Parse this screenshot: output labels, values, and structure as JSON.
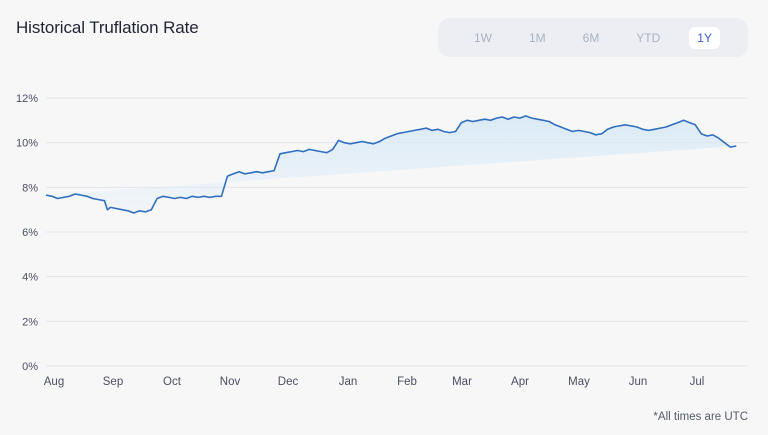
{
  "title": "Historical Truflation Rate",
  "range_selector": {
    "options": [
      "1W",
      "1M",
      "6M",
      "YTD",
      "1Y"
    ],
    "selected": "1Y"
  },
  "footnote": "*All times are UTC",
  "colors": {
    "line": "#2f6fbf",
    "fill_top": "#d9eaf7",
    "grid": "#e3e5ea",
    "axis_text": "#4b5060"
  },
  "chart_data": {
    "type": "area",
    "title": "Historical Truflation Rate",
    "xlabel": "",
    "ylabel": "",
    "x_ticks": [
      "Aug",
      "Sep",
      "Oct",
      "Nov",
      "Dec",
      "Jan",
      "Feb",
      "Mar",
      "Apr",
      "May",
      "Jun",
      "Jul"
    ],
    "y_ticks": [
      "0%",
      "2%",
      "4%",
      "6%",
      "8%",
      "10%",
      "12%"
    ],
    "ylim": [
      0,
      12
    ],
    "grid": true,
    "x": [
      0,
      0.1,
      0.2,
      0.3,
      0.4,
      0.5,
      0.6,
      0.7,
      0.8,
      0.9,
      1.0,
      1.05,
      1.1,
      1.2,
      1.3,
      1.4,
      1.5,
      1.6,
      1.7,
      1.8,
      1.9,
      2.0,
      2.1,
      2.2,
      2.3,
      2.4,
      2.5,
      2.6,
      2.7,
      2.8,
      2.9,
      3.0,
      3.1,
      3.15,
      3.2,
      3.3,
      3.4,
      3.5,
      3.6,
      3.7,
      3.8,
      3.9,
      4.0,
      4.1,
      4.2,
      4.3,
      4.4,
      4.5,
      4.6,
      4.7,
      4.8,
      4.9,
      5.0,
      5.1,
      5.2,
      5.3,
      5.4,
      5.5,
      5.6,
      5.7,
      5.8,
      5.9,
      6.0,
      6.1,
      6.2,
      6.3,
      6.4,
      6.5,
      6.6,
      6.7,
      6.8,
      6.9,
      7.0,
      7.1,
      7.2,
      7.3,
      7.4,
      7.5,
      7.6,
      7.7,
      7.8,
      7.9,
      8.0,
      8.1,
      8.2,
      8.3,
      8.4,
      8.5,
      8.6,
      8.7,
      8.8,
      8.9,
      9.0,
      9.1,
      9.2,
      9.3,
      9.4,
      9.5,
      9.6,
      9.7,
      9.8,
      9.9,
      10.0,
      10.1,
      10.2,
      10.3,
      10.4,
      10.5,
      10.6,
      10.7,
      10.8,
      10.9,
      11.0,
      11.1,
      11.2,
      11.3,
      11.4,
      11.5,
      11.6,
      11.7,
      11.8,
      11.9,
      12.0
    ],
    "series": [
      {
        "values": [
          7.65,
          7.6,
          7.5,
          7.55,
          7.6,
          7.7,
          7.65,
          7.6,
          7.5,
          7.45,
          7.4,
          7.0,
          7.1,
          7.05,
          7.0,
          6.95,
          6.85,
          6.95,
          6.9,
          7.0,
          7.5,
          7.6,
          7.55,
          7.5,
          7.55,
          7.5,
          7.6,
          7.55,
          7.6,
          7.55,
          7.6,
          7.6,
          8.5,
          8.55,
          8.6,
          8.7,
          8.6,
          8.65,
          8.7,
          8.65,
          8.7,
          8.75,
          9.5,
          9.55,
          9.6,
          9.65,
          9.6,
          9.7,
          9.65,
          9.6,
          9.55,
          9.7,
          10.1,
          10.0,
          9.95,
          10.0,
          10.05,
          10.0,
          9.95,
          10.05,
          10.2,
          10.3,
          10.4,
          10.45,
          10.5,
          10.55,
          10.6,
          10.65,
          10.55,
          10.6,
          10.5,
          10.45,
          10.5,
          10.9,
          11.0,
          10.95,
          11.0,
          11.05,
          11.0,
          11.1,
          11.15,
          11.05,
          11.15,
          11.1,
          11.2,
          11.1,
          11.05,
          11.0,
          10.95,
          10.8,
          10.7,
          10.6,
          10.5,
          10.55,
          10.5,
          10.45,
          10.35,
          10.4,
          10.6,
          10.7,
          10.75,
          10.8,
          10.75,
          10.7,
          10.6,
          10.55,
          10.6,
          10.65,
          10.7,
          10.8,
          10.9,
          11.0,
          10.9,
          10.8,
          10.4,
          10.3,
          10.35,
          10.2,
          10.0,
          9.8,
          9.85
        ]
      }
    ]
  }
}
